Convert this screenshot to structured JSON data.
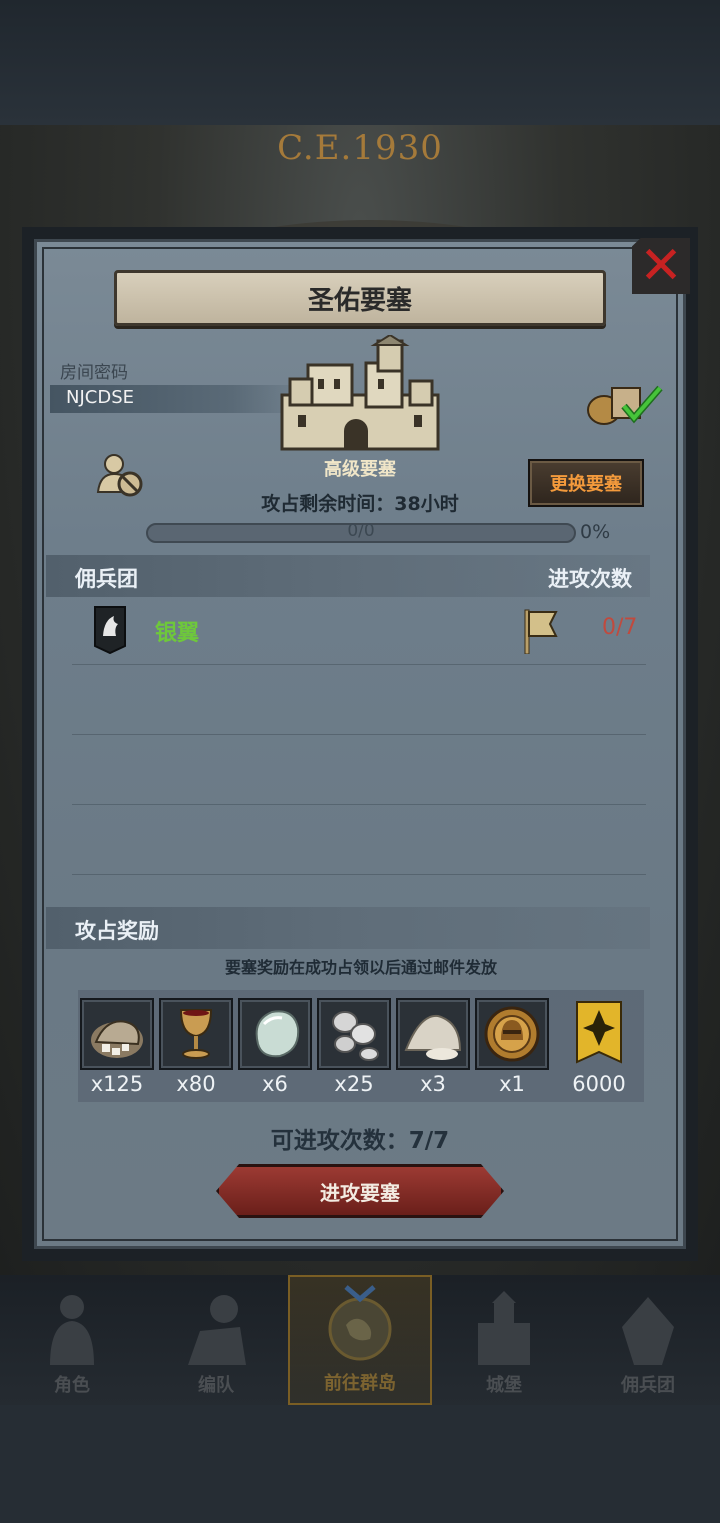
{
  "background": {
    "year": "C.E.1930"
  },
  "modal": {
    "title": "圣佑要塞",
    "close_icon": "close-x-icon",
    "room_label": "房间密码",
    "room_code": "NJCDSE",
    "fortress_level": "高级要塞",
    "change_button": "更换要塞",
    "remaining_time": "攻占剩余时间：38小时",
    "progress": {
      "text": "0/0",
      "percent": "0%",
      "fraction": 0
    }
  },
  "mercenary_section": {
    "title": "佣兵团",
    "right_title": "进攻次数",
    "rows": [
      {
        "name": "银翼",
        "attack_count": "0/7"
      }
    ]
  },
  "reward_section": {
    "title": "攻占奖励",
    "note": "要塞奖励在成功占领以后通过邮件发放",
    "items": [
      {
        "icon": "ore-pile-icon",
        "qty": "x125"
      },
      {
        "icon": "goblet-icon",
        "qty": "x80"
      },
      {
        "icon": "gem-stone-icon",
        "qty": "x6"
      },
      {
        "icon": "silver-coins-icon",
        "qty": "x25"
      },
      {
        "icon": "salt-pile-icon",
        "qty": "x3"
      },
      {
        "icon": "helmet-medal-icon",
        "qty": "x1"
      },
      {
        "icon": "rank-banner-icon",
        "qty": "6000"
      }
    ]
  },
  "attempts_text": "可进攻次数：7/7",
  "attack_button": "进攻要塞",
  "bottom_nav": [
    {
      "label": "角色",
      "icon": "knight-icon"
    },
    {
      "label": "编队",
      "icon": "formation-icon"
    },
    {
      "label": "前往群岛",
      "icon": "compass-icon",
      "active": true
    },
    {
      "label": "城堡",
      "icon": "castle-icon"
    },
    {
      "label": "佣兵团",
      "icon": "mercenary-icon"
    }
  ],
  "colors": {
    "accent_orange": "#f39a3c",
    "guild_green": "#6ec83b",
    "count_red": "#c04a3e",
    "close_red": "#c72222"
  }
}
